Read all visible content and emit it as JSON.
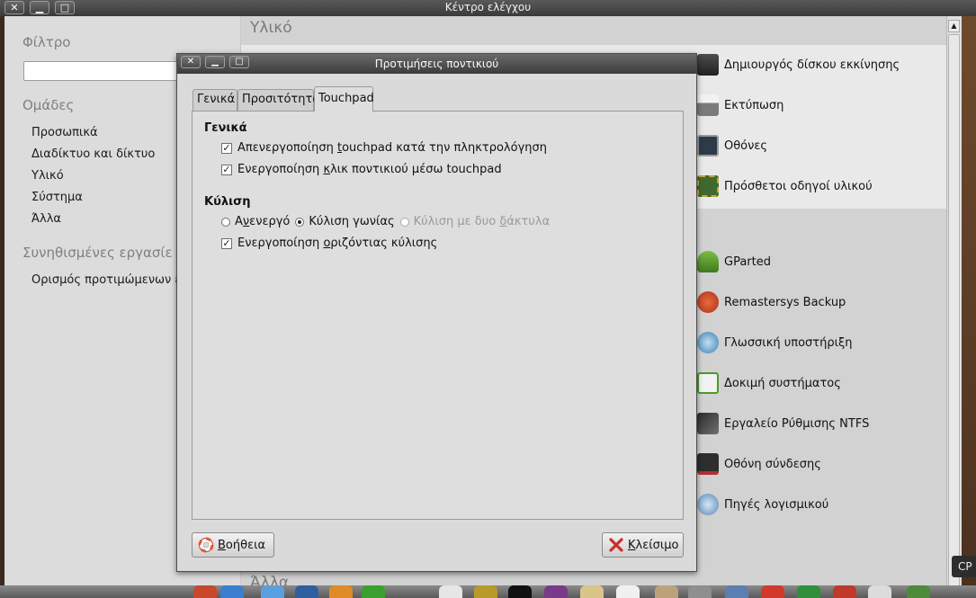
{
  "window": {
    "title": "Κέντρο ελέγχου",
    "close_glyph": "✕",
    "minimize_glyph": "▁",
    "maximize_glyph": "□"
  },
  "sidebar": {
    "filter_label": "Φίλτρο",
    "filter_value": "",
    "groups_label": "Ομάδες",
    "groups": [
      {
        "label": "Προσωπικά"
      },
      {
        "label": "Διαδίκτυο και δίκτυο"
      },
      {
        "label": "Υλικό"
      },
      {
        "label": "Σύστημα"
      },
      {
        "label": "Άλλα"
      }
    ],
    "common_tasks_label": "Συνηθισμένες εργασίε",
    "common_tasks": [
      {
        "label": "Ορισμός προτιμώμενων εφ"
      }
    ]
  },
  "main": {
    "category_hardware": "Υλικό",
    "category_other": "Άλλα",
    "hardware_items": [
      {
        "label": "Δημιουργός δίσκου εκκίνησης",
        "icon": "usb-disk-icon"
      },
      {
        "label": "Εκτύπωση",
        "icon": "printer-icon"
      },
      {
        "label": "Οθόνες",
        "icon": "monitor-icon"
      },
      {
        "label": "Πρόσθετοι οδηγοί υλικού",
        "icon": "chip-icon"
      }
    ],
    "system_items": [
      {
        "label": "GParted",
        "icon": "gparted-icon"
      },
      {
        "label": "Remastersys Backup",
        "icon": "remastersys-icon"
      },
      {
        "label": "Γλωσσική υποστήριξη",
        "icon": "language-icon"
      },
      {
        "label": "Δοκιμή συστήματος",
        "icon": "system-test-icon"
      },
      {
        "label": "Εργαλείο Ρύθμισης NTFS",
        "icon": "ntfs-tool-icon"
      },
      {
        "label": "Οθόνη σύνδεσης",
        "icon": "login-screen-icon"
      },
      {
        "label": "Πηγές λογισμικού",
        "icon": "software-sources-icon"
      }
    ]
  },
  "panel": {
    "cpu_label": "CP"
  },
  "dialog": {
    "title": "Προτιμήσεις ποντικιού",
    "tabs": [
      {
        "label": "Γενικά",
        "active": false
      },
      {
        "label": "Προσιτότητα",
        "active": false
      },
      {
        "label": "Touchpad",
        "active": true
      }
    ],
    "general": {
      "heading": "Γενικά",
      "disable_while_typing": {
        "pre": "Απενεργοποίηση ",
        "accel": "t",
        "post": "ouchpad κατά την πληκτρολόγηση",
        "checked": true
      },
      "tap_to_click": {
        "pre": "Ενεργοποίηση ",
        "accel": "κ",
        "post": "λικ ποντικιού μέσω touchpad",
        "checked": true
      }
    },
    "scrolling": {
      "heading": "Κύλιση",
      "options": [
        {
          "pre": "Α",
          "accel": "ν",
          "post": "ενεργό",
          "selected": false,
          "disabled": false
        },
        {
          "pre": "",
          "accel": "",
          "post": "Κύλιση γωνίας",
          "selected": true,
          "disabled": false
        },
        {
          "pre": "Κύλιση με δυο ",
          "accel": "δ",
          "post": "άκτυλα",
          "selected": false,
          "disabled": true
        }
      ],
      "horizontal": {
        "pre": "Ενεργοποίηση ",
        "accel": "ο",
        "post": "ριζόντιας κύλισης",
        "checked": true
      }
    },
    "buttons": {
      "help": {
        "accel": "Β",
        "post": "οήθεια"
      },
      "close": {
        "accel": "Κ",
        "post": "λείσιμο"
      }
    }
  },
  "colors": {
    "dock_accent_green": "#3aa02f",
    "icon_red": "#c8312a"
  }
}
